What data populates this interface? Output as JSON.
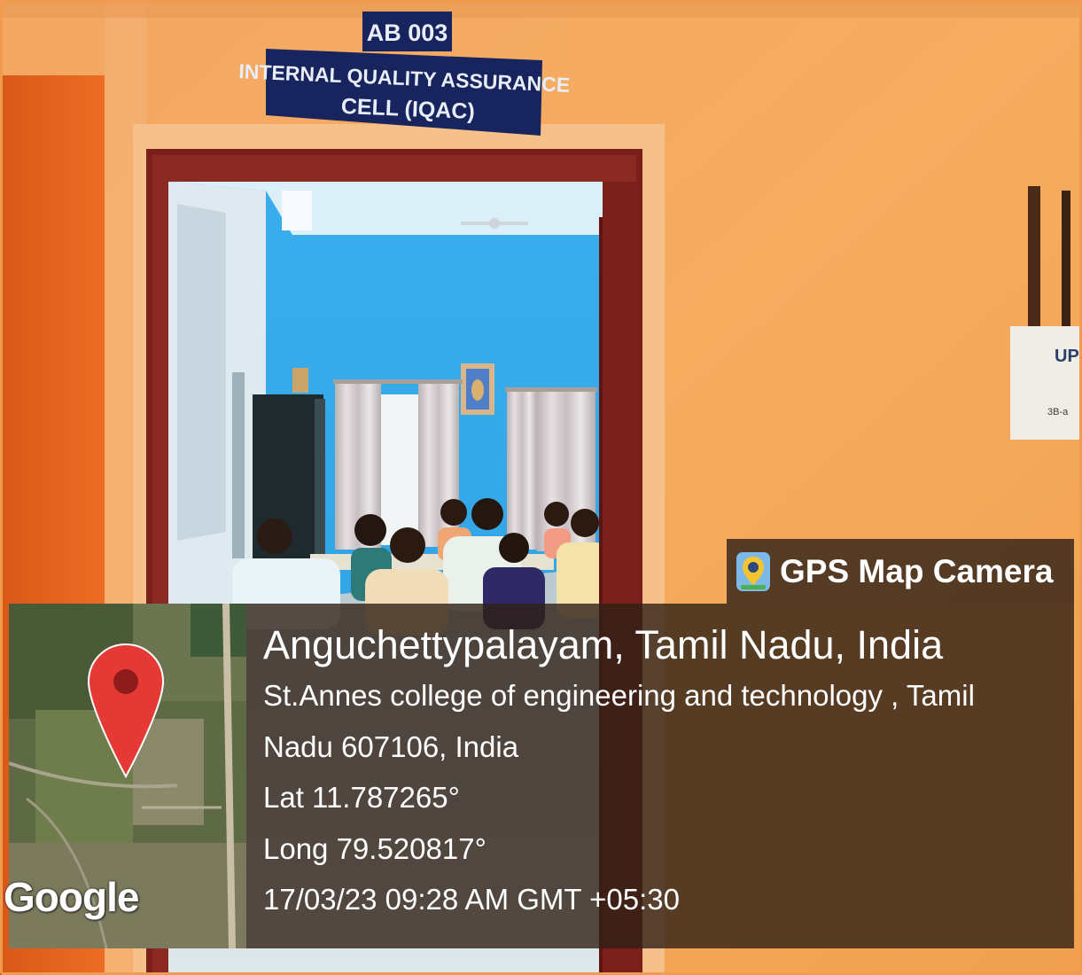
{
  "signs": {
    "room_number": "AB 003",
    "cell_line1": "INTERNAL QUALITY ASSURANCE",
    "cell_line2": "CELL (IQAC)"
  },
  "wall_box": {
    "label": "UP",
    "small_text": "3B-a"
  },
  "gps_overlay": {
    "app_name": "GPS Map Camera",
    "app_icon": "map-pin-camera-icon",
    "place": "Anguchettypalayam, Tamil Nadu, India",
    "address_line1": "St.Annes college of engineering and technology , Tamil",
    "address_line2": "Nadu 607106, India",
    "lat": "Lat 11.787265°",
    "long": "Long 79.520817°",
    "datetime": "17/03/23 09:28 AM GMT +05:30",
    "map_attribution": "Google",
    "pin_color": "#e53935"
  },
  "colors": {
    "wall": "#f4a259",
    "door_frame": "#7a1f1a",
    "room_wall": "#2fa8ea",
    "orange_pillar": "#e8601c",
    "sign_bg": "#17245e"
  }
}
